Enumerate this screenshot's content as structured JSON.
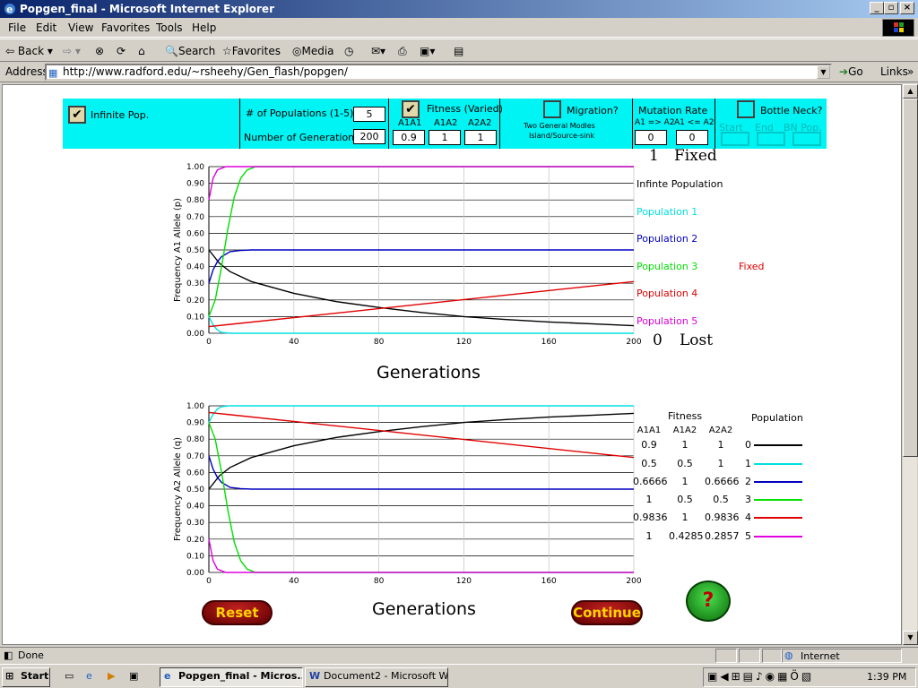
{
  "window": {
    "title": "Popgen_final - Microsoft Internet Explorer",
    "min": "_",
    "max": "▫",
    "close": "×"
  },
  "menu": [
    "File",
    "Edit",
    "View",
    "Favorites",
    "Tools",
    "Help"
  ],
  "toolbar": {
    "back": "Back",
    "search": "Search",
    "favorites": "Favorites",
    "media": "Media"
  },
  "address": {
    "label": "Address",
    "url": "http://www.radford.edu/~rsheehy/Gen_flash/popgen/",
    "go": "Go",
    "links": "Links"
  },
  "controls": {
    "infinite_pop": "Infinite Pop.",
    "num_populations_label": "# of Populations (1-5)",
    "num_populations": "5",
    "num_generations_label": "Number of Generations",
    "num_generations": "200",
    "fitness_label": "Fitness  (Varied)",
    "fit_headers": [
      "A1A1",
      "A1A2",
      "A2A2"
    ],
    "fit_values": [
      "0.9",
      "1",
      "1"
    ],
    "migration_label": "Migration?",
    "migration_sub1": "Two General Modles",
    "migration_sub2": "Island/Source-sink",
    "mutation_label": "Mutation Rate",
    "mutation_headers": [
      "A1 => A2",
      "A1 <= A2"
    ],
    "mutation_values": [
      "0",
      "0"
    ],
    "bottleneck_label": "Bottle Neck?",
    "bottleneck_headers": [
      "Start",
      "End",
      "BN Pop."
    ]
  },
  "chart_data": [
    {
      "type": "line",
      "ylabel": "Frequency A1 Allele (p)",
      "xlabel": "Generations",
      "xlim": [
        0,
        200
      ],
      "ylim": [
        0,
        1
      ],
      "xticks": [
        "0",
        "40",
        "80",
        "120",
        "160",
        "200"
      ],
      "yticks": [
        "0.00",
        "0.10",
        "0.20",
        "0.30",
        "0.40",
        "0.50",
        "0.60",
        "0.70",
        "0.80",
        "0.90",
        "1.00"
      ],
      "series": [
        {
          "name": "Infinte Population",
          "color": "#000000",
          "x": [
            0,
            5,
            10,
            20,
            40,
            60,
            80,
            100,
            120,
            140,
            160,
            180,
            200
          ],
          "values": [
            0.5,
            0.42,
            0.37,
            0.31,
            0.24,
            0.19,
            0.155,
            0.125,
            0.1,
            0.082,
            0.068,
            0.057,
            0.045
          ]
        },
        {
          "name": "Population 1",
          "color": "#00e0e0",
          "x": [
            0,
            2,
            4,
            6,
            10,
            200
          ],
          "values": [
            0.1,
            0.05,
            0.02,
            0.005,
            0,
            0
          ]
        },
        {
          "name": "Population 2",
          "color": "#0000c0",
          "x": [
            0,
            2,
            4,
            6,
            10,
            15,
            20,
            200
          ],
          "values": [
            0.3,
            0.38,
            0.43,
            0.46,
            0.49,
            0.497,
            0.5,
            0.5
          ]
        },
        {
          "name": "Population 3",
          "color": "#00e000",
          "x": [
            0,
            3,
            6,
            9,
            12,
            15,
            18,
            22,
            200
          ],
          "values": [
            0.1,
            0.2,
            0.4,
            0.63,
            0.82,
            0.93,
            0.98,
            1.0,
            1.0
          ]
        },
        {
          "name": "Population 4",
          "color": "#e00000",
          "x": [
            0,
            200
          ],
          "values": [
            0.04,
            0.31
          ]
        },
        {
          "name": "Population 5",
          "color": "#e000e0",
          "x": [
            0,
            2,
            4,
            8,
            200
          ],
          "values": [
            0.8,
            0.93,
            0.98,
            1.0,
            1.0
          ]
        }
      ],
      "fixed_count": "1",
      "fixed_label": "Fixed",
      "fixed_note": "Fixed",
      "lost_count": "0",
      "lost_label": "Lost"
    },
    {
      "type": "line",
      "ylabel": "Frequency A2 Allele (q)",
      "xlabel": "Generations",
      "xlim": [
        0,
        200
      ],
      "ylim": [
        0,
        1
      ],
      "xticks": [
        "0",
        "40",
        "80",
        "120",
        "160",
        "200"
      ],
      "yticks": [
        "0.00",
        "0.10",
        "0.20",
        "0.30",
        "0.40",
        "0.50",
        "0.60",
        "0.70",
        "0.80",
        "0.90",
        "1.00"
      ],
      "series": [
        {
          "name": "0",
          "color": "#000000",
          "x": [
            0,
            5,
            10,
            20,
            40,
            60,
            80,
            100,
            120,
            140,
            160,
            180,
            200
          ],
          "values": [
            0.5,
            0.58,
            0.63,
            0.69,
            0.76,
            0.81,
            0.845,
            0.875,
            0.9,
            0.918,
            0.932,
            0.943,
            0.955
          ]
        },
        {
          "name": "1",
          "color": "#00e0e0",
          "x": [
            0,
            2,
            4,
            6,
            10,
            200
          ],
          "values": [
            0.9,
            0.95,
            0.98,
            0.995,
            1.0,
            1.0
          ]
        },
        {
          "name": "2",
          "color": "#0000c0",
          "x": [
            0,
            2,
            4,
            6,
            10,
            15,
            20,
            200
          ],
          "values": [
            0.7,
            0.62,
            0.57,
            0.54,
            0.51,
            0.503,
            0.5,
            0.5
          ]
        },
        {
          "name": "3",
          "color": "#00e000",
          "x": [
            0,
            3,
            6,
            9,
            12,
            15,
            18,
            22,
            200
          ],
          "values": [
            0.9,
            0.8,
            0.6,
            0.37,
            0.18,
            0.07,
            0.02,
            0.0,
            0.0
          ]
        },
        {
          "name": "4",
          "color": "#e00000",
          "x": [
            0,
            200
          ],
          "values": [
            0.96,
            0.69
          ]
        },
        {
          "name": "5",
          "color": "#e000e0",
          "x": [
            0,
            2,
            4,
            8,
            200
          ],
          "values": [
            0.2,
            0.07,
            0.02,
            0.0,
            0.0
          ]
        }
      ],
      "fitness_title": "Fitness",
      "population_title": "Population",
      "fitness_headers": [
        "A1A1",
        "A1A2",
        "A2A2"
      ],
      "fitness_rows": [
        [
          "0.9",
          "1",
          "1"
        ],
        [
          "0.5",
          "0.5",
          "1"
        ],
        [
          "0.6666",
          "1",
          "0.6666"
        ],
        [
          "1",
          "0.5",
          "0.5"
        ],
        [
          "0.9836",
          "1",
          "0.9836"
        ],
        [
          "1",
          "0.4285",
          "0.2857"
        ]
      ]
    }
  ],
  "buttons": {
    "reset": "Reset",
    "continue": "Continue",
    "help": "?"
  },
  "status": {
    "done": "Done",
    "zone": "Internet"
  },
  "taskbar": {
    "start": "Start",
    "task1": "Popgen_final - Micros...",
    "task2": "Document2 - Microsoft W...",
    "clock": "1:39 PM"
  },
  "colors": {
    "panel": "#00f4f4",
    "titlebar": "#0a246a"
  }
}
